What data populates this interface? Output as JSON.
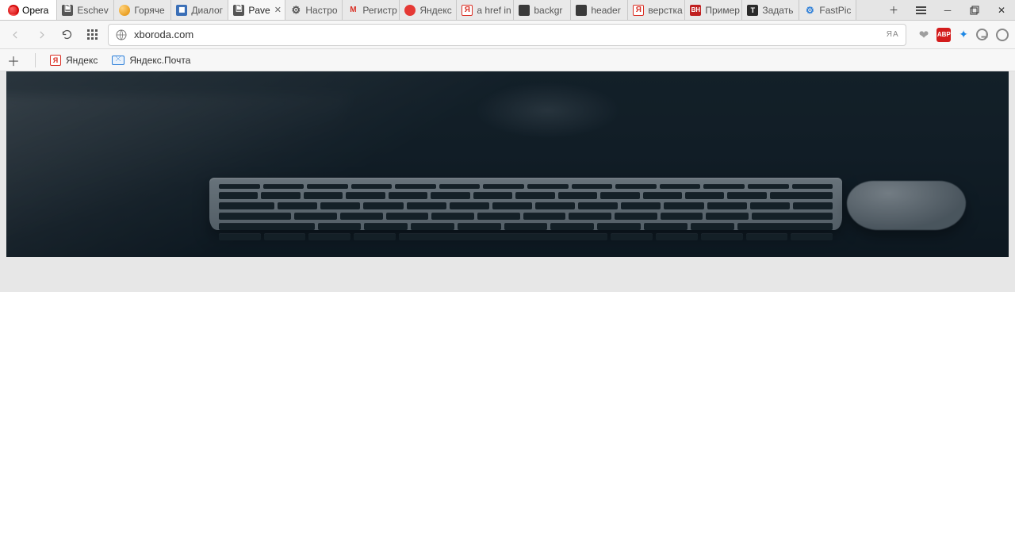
{
  "window": {
    "app_name": "Opera"
  },
  "tabs": [
    {
      "label": "Eschev",
      "favicon": "page"
    },
    {
      "label": "Горяче",
      "favicon": "orange-ball"
    },
    {
      "label": "Диалог",
      "favicon": "blue-square"
    },
    {
      "label": "Pave",
      "favicon": "page",
      "active": true,
      "closeable": true
    },
    {
      "label": "Настро",
      "favicon": "gear"
    },
    {
      "label": "Регистр",
      "favicon": "gmail"
    },
    {
      "label": "Яндекс",
      "favicon": "yandex-red"
    },
    {
      "label": "a href in",
      "favicon": "ya-box"
    },
    {
      "label": "backgr",
      "favicon": "dark-page"
    },
    {
      "label": "header",
      "favicon": "dark-page"
    },
    {
      "label": "верстка",
      "favicon": "ya-box"
    },
    {
      "label": "Пример",
      "favicon": "bh"
    },
    {
      "label": "Задать",
      "favicon": "t"
    },
    {
      "label": "FastPic",
      "favicon": "fast"
    }
  ],
  "address_bar": {
    "url": "xboroda.com",
    "translate_label": "ЯA"
  },
  "extensions": {
    "abp_label": "ABP"
  },
  "bookmarks": [
    {
      "label": "Яндекс",
      "icon": "ya-box"
    },
    {
      "label": "Яндекс.Почта",
      "icon": "mail"
    }
  ]
}
